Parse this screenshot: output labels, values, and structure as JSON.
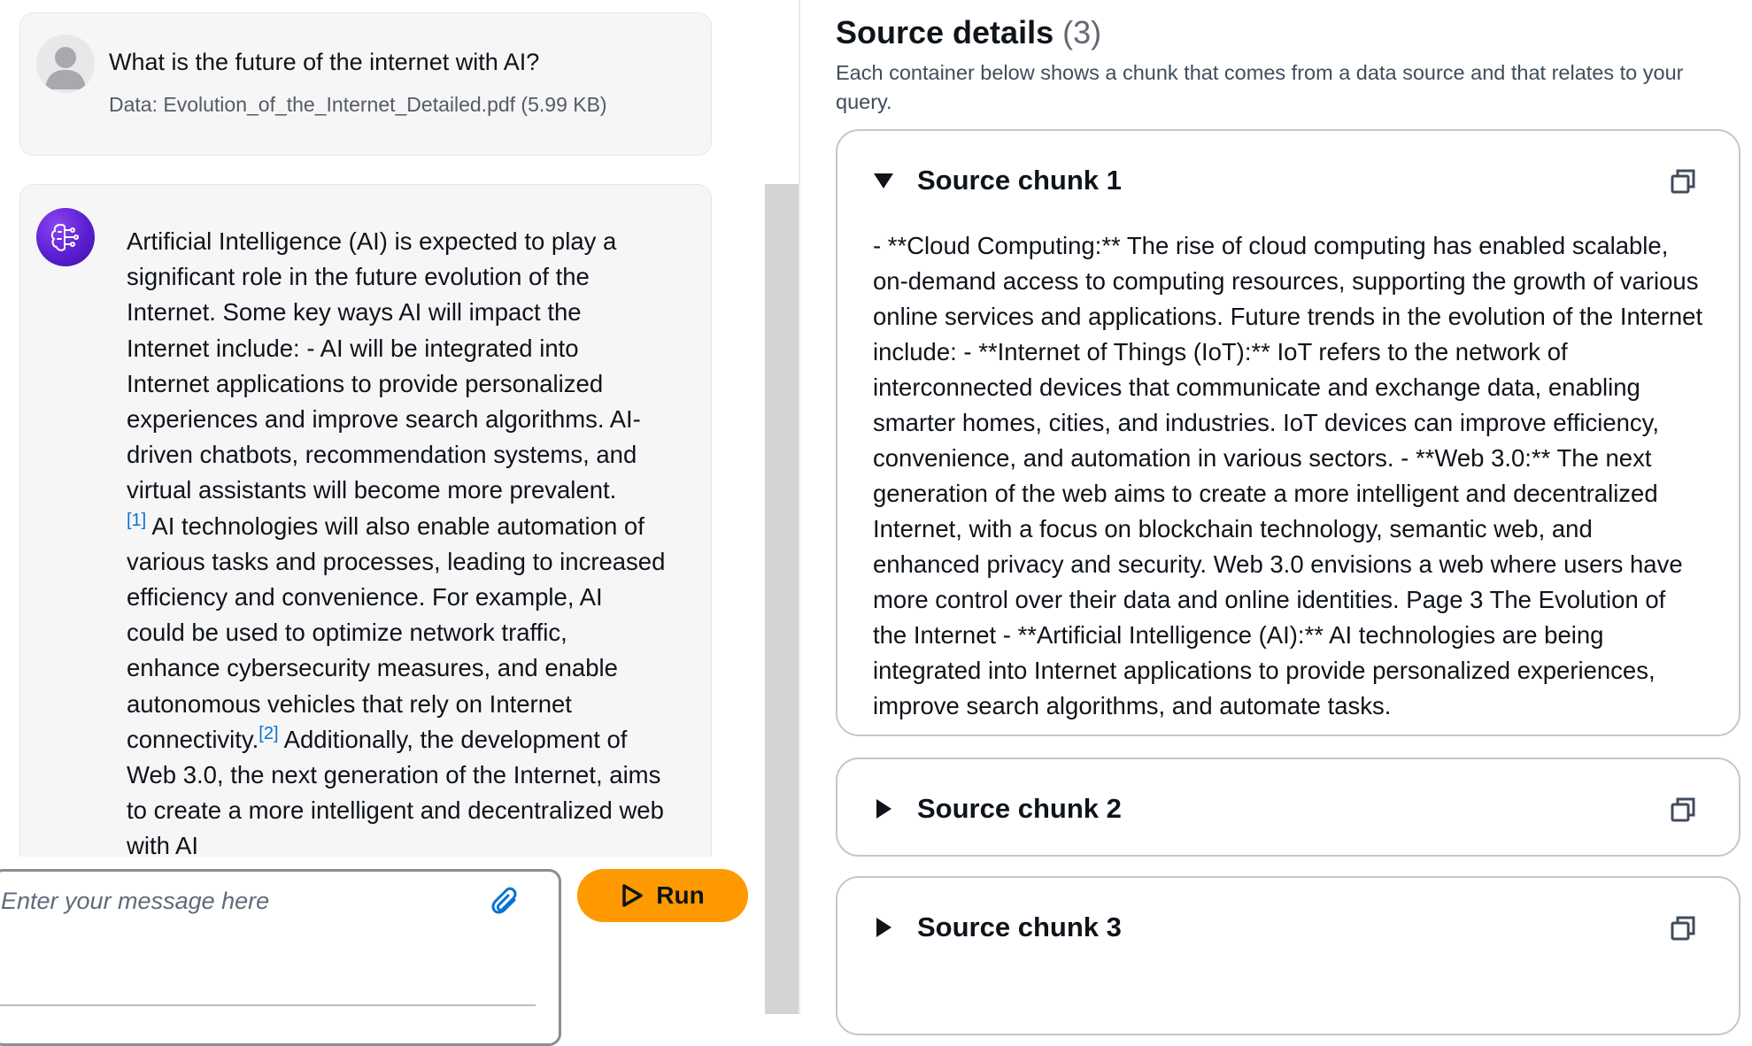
{
  "chat": {
    "user": {
      "question": "What is the future of the internet with AI?",
      "data_file": "Data: Evolution_of_the_Internet_Detailed.pdf (5.99 KB)"
    },
    "answer": {
      "part1": "Artificial Intelligence (AI) is expected to play a significant role in the future evolution of the Internet. Some key ways AI will impact the Internet include: - AI will be integrated into Internet applications to provide personalized experiences and improve search algorithms. AI-driven chatbots, recommendation systems, and virtual assistants will become more prevalent.",
      "cite1": "[1]",
      "part2": " AI technologies will also enable automation of various tasks and processes, leading to increased efficiency and convenience. For example, AI could be used to optimize network traffic, enhance cybersecurity measures, and enable autonomous vehicles that rely on Internet connectivity.",
      "cite2": "[2]",
      "part3": " Additionally, the development of Web 3.0, the next generation of the Internet, aims to create a more intelligent and decentralized web with AI"
    },
    "input": {
      "placeholder": "Enter your message here",
      "value": ""
    },
    "run_label": "Run"
  },
  "source_details": {
    "title": "Source details",
    "count": "(3)",
    "description": "Each container below shows a chunk that comes from a data source and that relates to your query.",
    "chunks": [
      {
        "title": "Source chunk 1",
        "expanded": true,
        "text": "- **Cloud Computing:** The rise of cloud computing has enabled scalable, on-demand access to computing resources, supporting the growth of various online services and applications. Future trends in the evolution of the Internet include: - **Internet of Things (IoT):** IoT refers to the network of interconnected devices that communicate and exchange data, enabling smarter homes, cities, and industries. IoT devices can improve efficiency, convenience, and automation in various sectors. - **Web 3.0:** The next generation of the web aims to create a more intelligent and decentralized Internet, with a focus on blockchain technology, semantic web, and enhanced privacy and security. Web 3.0 envisions a web where users have more control over their data and online identities. Page 3 The Evolution of the Internet - **Artificial Intelligence (AI):** AI technologies are being integrated into Internet applications to provide personalized experiences, improve search algorithms, and automate tasks."
      },
      {
        "title": "Source chunk 2",
        "expanded": false
      },
      {
        "title": "Source chunk 3",
        "expanded": false
      }
    ]
  },
  "colors": {
    "run_button": "#ff9900",
    "citation_link": "#0972d3",
    "ai_avatar": "#5a1fd1"
  },
  "icons": [
    "user-avatar-icon",
    "ai-brain-icon",
    "paperclip-icon",
    "play-icon",
    "caret-down-icon",
    "caret-right-icon",
    "copy-icon"
  ]
}
